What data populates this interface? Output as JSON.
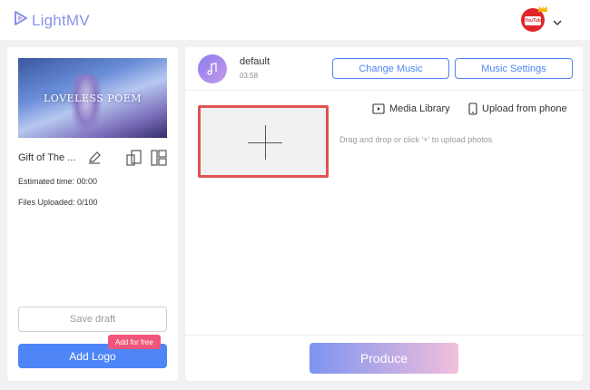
{
  "header": {
    "brand": "LightMV",
    "avatar_badge": "YouTube",
    "brand_color": "#8a93e8"
  },
  "project": {
    "thumbnail_title": "LOVELESS POEM",
    "name": "Gift of The ...",
    "estimated_time": "Estimated time: 00:00",
    "files_uploaded": "Files Uploaded: 0/100",
    "save_draft_label": "Save draft",
    "add_logo_label": "Add Logo",
    "add_free_badge": "Add for free"
  },
  "music": {
    "name": "default",
    "duration": "03:58",
    "change_music_label": "Change Music",
    "music_settings_label": "Music Settings"
  },
  "upload": {
    "media_library_label": "Media Library",
    "upload_phone_label": "Upload from phone",
    "hint": "Drag and drop or click '+' to upload photos"
  },
  "actions": {
    "produce_label": "Produce"
  },
  "colors": {
    "primary": "#4f86f7",
    "badge_pink": "#f0567b",
    "highlight_red": "#e05252"
  }
}
